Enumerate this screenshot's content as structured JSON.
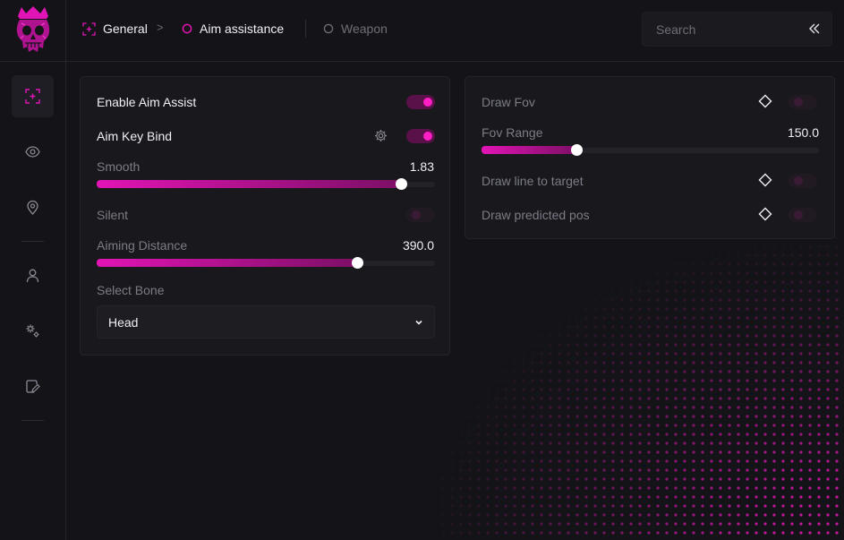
{
  "nav": {
    "items": [
      {
        "icon": "crosshair-icon",
        "active": true
      },
      {
        "icon": "eye-icon",
        "active": false
      },
      {
        "icon": "map-pin-icon",
        "active": false
      },
      {
        "icon": "user-icon",
        "active": false
      },
      {
        "icon": "settings-icon",
        "active": false
      },
      {
        "icon": "edit-icon",
        "active": false
      }
    ]
  },
  "breadcrumb": {
    "general": "General",
    "separator": ">",
    "aim": "Aim assistance",
    "weapon": "Weapon"
  },
  "search": {
    "placeholder": "Search"
  },
  "aim_panel": {
    "enable_label": "Enable Aim Assist",
    "enable_on": true,
    "keybind_label": "Aim Key Bind",
    "keybind_on": true,
    "smooth_label": "Smooth",
    "smooth_value": "1.83",
    "smooth_fraction": 0.9,
    "silent_label": "Silent",
    "silent_on": false,
    "distance_label": "Aiming Distance",
    "distance_value": "390.0",
    "distance_fraction": 0.77,
    "bone_label": "Select Bone",
    "bone_value": "Head"
  },
  "fov_panel": {
    "draw_fov_label": "Draw Fov",
    "draw_fov_on": false,
    "fov_range_label": "Fov Range",
    "fov_range_value": "150.0",
    "fov_range_fraction": 0.28,
    "draw_line_label": "Draw line to target",
    "draw_line_on": false,
    "draw_pred_label": "Draw predicted pos",
    "draw_pred_on": false
  },
  "colors": {
    "accent": "#e214b5",
    "background": "#141418",
    "panel": "#18181d"
  }
}
